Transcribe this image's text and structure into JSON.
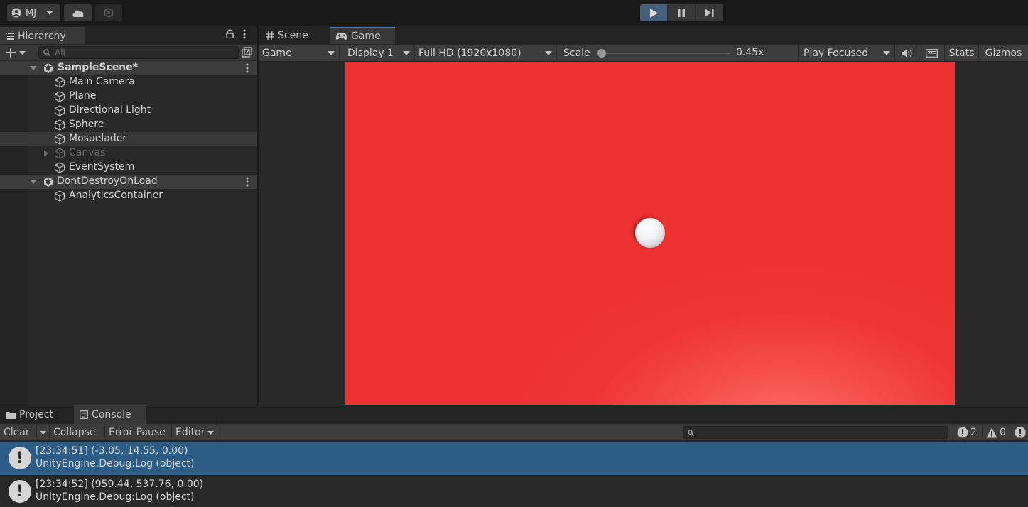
{
  "toolbar": {
    "account_label": "MJ",
    "play_state": "playing"
  },
  "hierarchy": {
    "tab_label": "Hierarchy",
    "search_placeholder": "All",
    "rows": [
      {
        "label": "SampleScene*",
        "kind": "scene"
      },
      {
        "label": "Main Camera",
        "kind": "object"
      },
      {
        "label": "Plane",
        "kind": "object"
      },
      {
        "label": "Directional Light",
        "kind": "object"
      },
      {
        "label": "Sphere",
        "kind": "object"
      },
      {
        "label": "Mosuelader",
        "kind": "object"
      },
      {
        "label": "Canvas",
        "kind": "object-inactive"
      },
      {
        "label": "EventSystem",
        "kind": "object"
      },
      {
        "label": "DontDestroyOnLoad",
        "kind": "scene"
      },
      {
        "label": "AnalyticsContainer",
        "kind": "object"
      }
    ]
  },
  "game": {
    "tab_scene": "Scene",
    "tab_game": "Game",
    "view_mode": "Game",
    "display": "Display 1",
    "resolution": "Full HD (1920x1080)",
    "scale_label": "Scale",
    "scale_value": "0.45x",
    "play_mode": "Play Focused",
    "stats": "Stats",
    "gizmos": "Gizmos",
    "background_color": "#ee3131"
  },
  "console": {
    "tab_project": "Project",
    "tab_console": "Console",
    "clear": "Clear",
    "collapse": "Collapse",
    "error_pause": "Error Pause",
    "editor": "Editor",
    "info_count": "2",
    "warn_count": "0",
    "entries": [
      {
        "line1": "[23:34:51] (-3.05, 14.55, 0.00)",
        "line2": "UnityEngine.Debug:Log (object)"
      },
      {
        "line1": "[23:34:52] (959.44, 537.76, 0.00)",
        "line2": "UnityEngine.Debug:Log (object)"
      }
    ]
  }
}
